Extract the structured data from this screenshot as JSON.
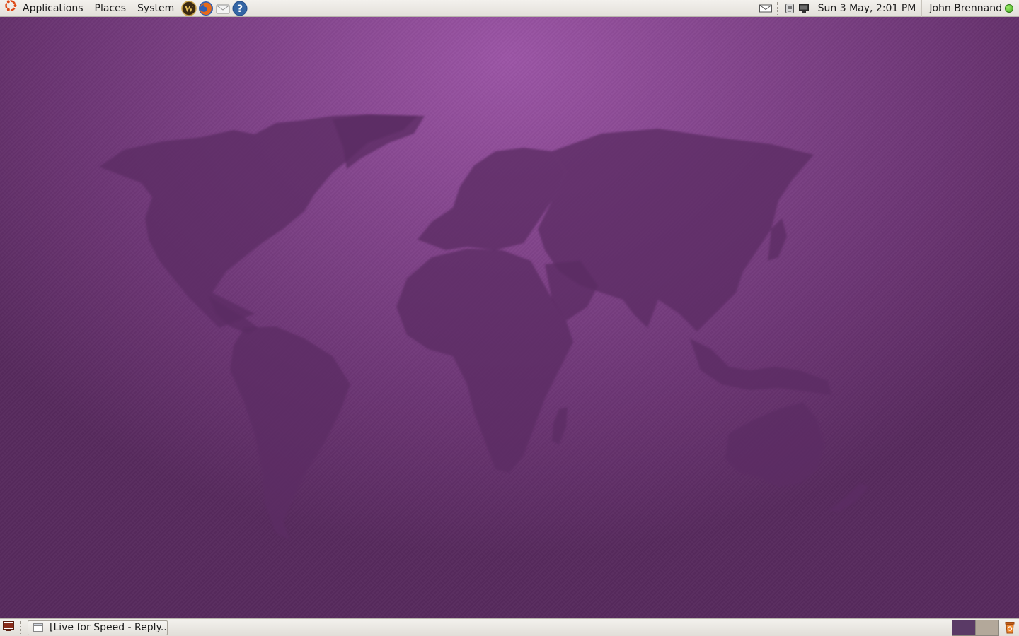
{
  "top_panel": {
    "menus": {
      "applications": "Applications",
      "places": "Places",
      "system": "System"
    },
    "launchers": [
      "wow-icon",
      "firefox-icon",
      "mail-launcher-icon",
      "help-icon"
    ],
    "tray_icons": [
      "mail-indicator-icon",
      "network-icon",
      "display-icon"
    ],
    "clock": "Sun  3 May,  2:01 PM",
    "user": "John Brennand",
    "status_color": "#4fbf2a"
  },
  "desktop": {
    "wallpaper": "world-map",
    "background_color": "#7a3e82"
  },
  "bottom_panel": {
    "tasks": [
      {
        "label": "[Live for Speed - Reply..."
      }
    ],
    "workspaces": [
      {
        "name": "workspace-1",
        "active": true
      },
      {
        "name": "workspace-2",
        "active": false
      }
    ]
  }
}
